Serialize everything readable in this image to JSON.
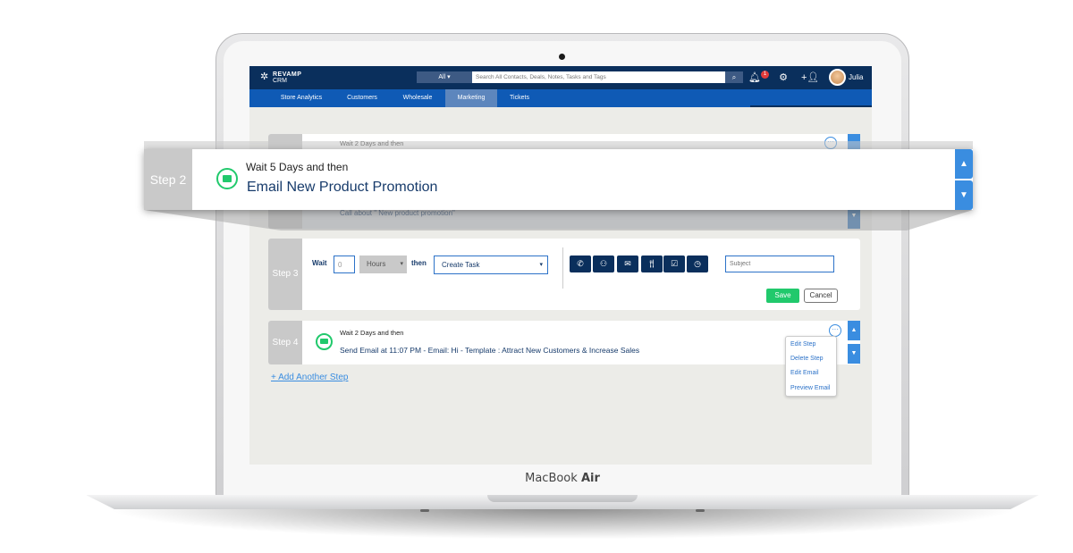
{
  "device": {
    "brand_regular": "MacBook",
    "brand_bold": "Air"
  },
  "app": {
    "logo_line1": "REVAMP",
    "logo_line2": "CRM",
    "search_category": "All",
    "search_placeholder": "Search All Contacts, Deals, Notes, Tasks and Tags",
    "notification_count": "1",
    "username": "Julia",
    "colors": {
      "topbar": "#0a2f5c",
      "navbar": "#0f5ab5",
      "accent": "#3a8de0",
      "success": "#21c96c"
    }
  },
  "nav": {
    "items": [
      {
        "label": "Store Analytics"
      },
      {
        "label": "Customers"
      },
      {
        "label": "Wholesale"
      },
      {
        "label": "Marketing"
      },
      {
        "label": "Tickets"
      }
    ],
    "active": "Marketing"
  },
  "steps": {
    "step1": {
      "wait_text": "Wait 2 Days and then"
    },
    "step_behind": {
      "label": "Step 2",
      "action": "Call about \" New product promotion\""
    },
    "step3": {
      "label": "Step 3",
      "wait_label": "Wait",
      "wait_value": "0",
      "unit": "Hours",
      "then_label": "then",
      "action_select": "Create Task",
      "task_types": [
        "phone-icon",
        "meeting-icon",
        "email-icon",
        "meal-icon",
        "todo-icon",
        "clock-icon"
      ],
      "subject_placeholder": "Subject",
      "save_label": "Save",
      "cancel_label": "Cancel"
    },
    "step4": {
      "label": "Step 4",
      "wait_text": "Wait 2 Days and then",
      "action": "Send Email at 11:07 PM - Email: Hi - Template : Attract New Customers & Increase Sales"
    }
  },
  "step_menu": {
    "items": [
      "Edit Step",
      "Delete Step",
      "Edit Email",
      "Preview Email"
    ]
  },
  "add_step_label": "+ Add Another Step",
  "callout": {
    "step_label": "Step 2",
    "wait_text": "Wait 5 Days and then",
    "title": "Email New Product Promotion"
  }
}
